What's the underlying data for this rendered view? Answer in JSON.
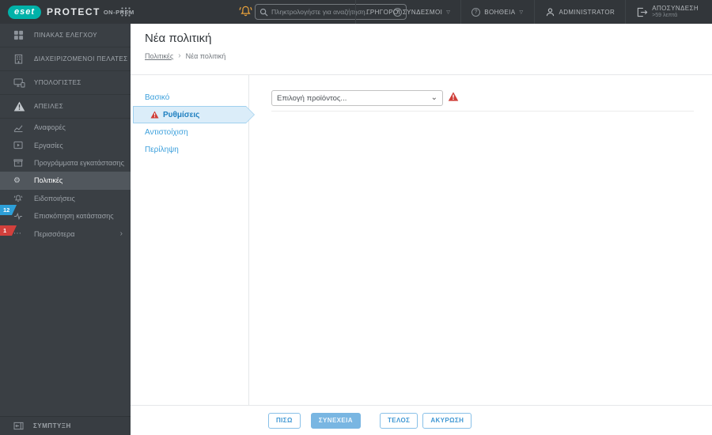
{
  "topbar": {
    "brand": {
      "logo": "eset",
      "product": "PROTECT",
      "edition": "ON-PREM"
    },
    "search_placeholder": "Πληκτρολογήστε για αναζήτηση...",
    "menu": {
      "quick_links": "ΓΡΗΓΟΡΟΙ ΣΥΝΔΕΣΜΟΙ",
      "help": "ΒΟΗΘΕΙΑ",
      "user": "ADMINISTRATOR",
      "logout": "ΑΠΟΣΥΝΔΕΣΗ",
      "logout_timer": ">59 λεπτά"
    }
  },
  "sidebar": {
    "primary_items": [
      {
        "label": "ΠΙΝΑΚΑΣ ΕΛΕΓΧΟΥ",
        "icon": "dashboard-icon"
      },
      {
        "label": "ΔΙΑΧΕΙΡΙΖΟΜΕΝΟΙ ΠΕΛΑΤΕΣ",
        "icon": "managed-clients-icon"
      },
      {
        "label": "ΥΠΟΛΟΓΙΣΤΕΣ",
        "icon": "computers-icon"
      },
      {
        "label": "ΑΠΕΙΛΕΣ",
        "icon": "threats-icon"
      }
    ],
    "secondary_items": [
      {
        "label": "Αναφορές",
        "icon": "reports-icon"
      },
      {
        "label": "Εργασίες",
        "icon": "tasks-icon"
      },
      {
        "label": "Προγράμματα εγκατάστασης",
        "icon": "installers-icon"
      },
      {
        "label": "Πολιτικές",
        "icon": "policies-icon",
        "active": true
      },
      {
        "label": "Ειδοποιήσεις",
        "icon": "notifications-icon"
      },
      {
        "label": "Επισκόπηση κατάστασης",
        "icon": "status-overview-icon",
        "badge": "12"
      },
      {
        "label": "Περισσότερα",
        "icon": "more-icon",
        "badge": "1"
      }
    ],
    "collapse_label": "ΣΥΜΠΤΥΞΗ"
  },
  "page": {
    "title": "Νέα πολιτική",
    "breadcrumb": {
      "parent": "Πολιτικές",
      "separator": "›",
      "current": "Νέα πολιτική"
    }
  },
  "wizard": {
    "steps": [
      {
        "label": "Βασικό"
      },
      {
        "label": "Ρυθμίσεις",
        "active": true,
        "warning": true
      },
      {
        "label": "Αντιστοίχιση"
      },
      {
        "label": "Περίληψη"
      }
    ]
  },
  "content": {
    "product_select_value": "Επιλογή προϊόντος...",
    "validation_warning": true
  },
  "footer": {
    "buttons": [
      {
        "label": "ΠΙΣΩ"
      },
      {
        "label": "ΣΥΝΕΧΕΙΑ",
        "primary": true
      },
      {
        "label": "ΤΕΛΟΣ"
      },
      {
        "label": "ΑΚΥΡΩΣΗ"
      }
    ]
  },
  "icons": {
    "policies_glyph": "⚙",
    "more_glyph": "⋯",
    "chevron_right_glyph": "›",
    "menu_chevron_glyph": "▽",
    "select_chevron_glyph": "⌄",
    "help_glyph": "?"
  },
  "colors": {
    "topbar_bg": "#32363a",
    "sidebar_bg": "#3a3f44",
    "active_item_bg": "#51575d",
    "eset_teal": "#00b2a9",
    "bell_orange": "#e9a23b",
    "link_blue": "#3da0dc",
    "active_step_blue": "#1e7fc0",
    "step_arrow_bg": "#dbedf9",
    "warning_red": "#cf3e38",
    "badge_blue": "#2d9fd8",
    "badge_red": "#d2403c",
    "button_primary_bg": "#79b6e2"
  }
}
